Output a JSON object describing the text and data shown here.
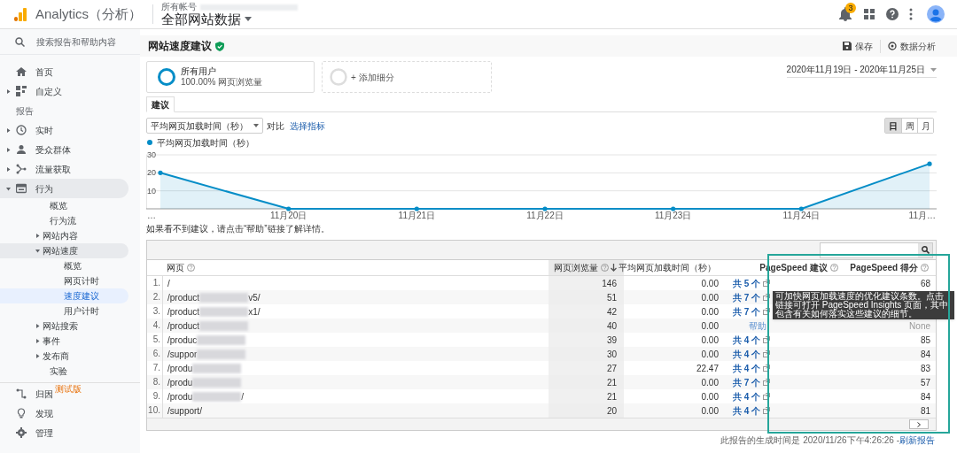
{
  "header": {
    "product": "Analytics（分析）",
    "account_label": "所有帐号",
    "property": "全部网站数据",
    "notification_count": "3"
  },
  "sidebar": {
    "search_placeholder": "搜索报告和帮助内容",
    "items": [
      {
        "label": "首页"
      },
      {
        "label": "自定义",
        "expanded": false
      },
      {
        "kind": "section",
        "label": "报告"
      },
      {
        "label": "实时",
        "expanded": false
      },
      {
        "label": "受众群体",
        "expanded": false
      },
      {
        "label": "流量获取",
        "expanded": false
      },
      {
        "label": "行为",
        "expanded": true,
        "children": [
          {
            "label": "概览",
            "selected": false
          },
          {
            "label": "行为流",
            "selected": false
          },
          {
            "label": "网站内容",
            "expanded": false,
            "selected": false
          },
          {
            "label": "网站速度",
            "expanded": true,
            "selected": false,
            "children": [
              {
                "label": "概览",
                "selected": false
              },
              {
                "label": "网页计时",
                "selected": false
              },
              {
                "label": "速度建议",
                "selected": true
              },
              {
                "label": "用户计时",
                "selected": false
              }
            ]
          },
          {
            "label": "网站搜索",
            "expanded": false,
            "selected": false
          },
          {
            "label": "事件",
            "expanded": false,
            "selected": false
          },
          {
            "label": "发布商",
            "expanded": false,
            "selected": false
          },
          {
            "label": "实验",
            "selected": false
          }
        ]
      }
    ],
    "bottom_items": [
      {
        "label": "归因",
        "badge": "测试版"
      },
      {
        "label": "发现"
      },
      {
        "label": "管理"
      }
    ]
  },
  "report": {
    "title": "网站速度建议",
    "actions": [
      "保存",
      "数据分析"
    ],
    "segments": [
      {
        "kind": "segment",
        "title": "所有用户",
        "subtitle": "100.00% 网页浏览量"
      },
      {
        "kind": "add",
        "title": "+ 添加细分"
      }
    ],
    "date_range": "2020年11月19日 - 2020年11月25日",
    "tabs": [
      {
        "label": "建议",
        "selected": true
      }
    ],
    "metric_select": "平均网页加载时间（秒）",
    "compare_label": "对比",
    "select_metric_link": "选择指标",
    "periods": [
      {
        "label": "日",
        "selected": true
      },
      {
        "label": "周",
        "selected": false
      },
      {
        "label": "月",
        "selected": false
      }
    ],
    "chart_data": {
      "type": "line",
      "categories": [
        "…",
        "11月20日",
        "11月21日",
        "11月22日",
        "11月23日",
        "11月24日",
        "11月…"
      ],
      "series": [
        {
          "name": "平均网页加载时间（秒）",
          "color": "#058dc7",
          "values": [
            20,
            0,
            0,
            0,
            0,
            0,
            25
          ]
        }
      ],
      "ylim": [
        0,
        30
      ],
      "yticks": [
        10,
        20,
        30
      ]
    },
    "note": "如果看不到建议，请点击“帮助”链接了解详情。"
  },
  "table": {
    "columns": [
      "网页",
      "网页浏览量",
      "平均网页加载时间（秒）",
      "PageSpeed 建议",
      "PageSpeed 得分"
    ],
    "rows": [
      {
        "index": "1.",
        "page_start": "/",
        "views": "146",
        "load_time": "0.00",
        "suggestions": "共 5 个",
        "score": "68"
      },
      {
        "index": "2.",
        "page_start": "/product",
        "page_end": "v5/",
        "views": "51",
        "load_time": "0.00",
        "suggestions": "共 7 个"
      },
      {
        "index": "3.",
        "page_start": "/product",
        "page_end": "x1/",
        "views": "42",
        "load_time": "0.00",
        "suggestions": "共 7 个"
      },
      {
        "index": "4.",
        "page_start": "/product",
        "views": "40",
        "load_time": "0.00",
        "help": "帮助",
        "score": "None"
      },
      {
        "index": "5.",
        "page_start": "/produc",
        "views": "39",
        "load_time": "0.00",
        "suggestions": "共 4 个",
        "score": "85"
      },
      {
        "index": "6.",
        "page_start": "/suppor",
        "views": "30",
        "load_time": "0.00",
        "suggestions": "共 4 个",
        "score": "84"
      },
      {
        "index": "7.",
        "page_start": "/produ",
        "views": "27",
        "load_time": "22.47",
        "suggestions": "共 4 个",
        "score": "83"
      },
      {
        "index": "8.",
        "page_start": "/produ",
        "views": "21",
        "load_time": "0.00",
        "suggestions": "共 7 个",
        "score": "57"
      },
      {
        "index": "9.",
        "page_start": "/produ",
        "page_end": "/",
        "views": "21",
        "load_time": "0.00",
        "suggestions": "共 4 个",
        "score": "84"
      },
      {
        "index": "10.",
        "page_start": "/support/",
        "views": "20",
        "load_time": "0.00",
        "suggestions": "共 4 个",
        "score": "81"
      }
    ],
    "tooltip": "可加快网页加载速度的优化建议条数。点击链接可打开 PageSpeed Insights 页面，其中包含有关如何落实这些建议的细节。"
  },
  "footer": {
    "generated": "此报告的生成时间是 2020/11/26下午4:26:26 - ",
    "refresh_link": "刷新报告"
  }
}
